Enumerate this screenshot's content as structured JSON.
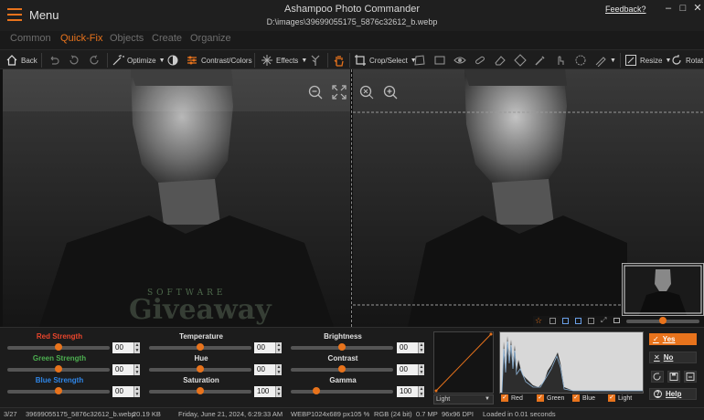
{
  "titlebar": {
    "menu_label": "Menu",
    "app_title": "Ashampoo Photo Commander",
    "file_path": "D:\\images\\39699055175_5876c32612_b.webp",
    "feedback_label": "Feedback?"
  },
  "tabs": [
    {
      "label": "Common",
      "active": false
    },
    {
      "label": "Quick-Fix",
      "active": true
    },
    {
      "label": "Objects",
      "active": false
    },
    {
      "label": "Create",
      "active": false
    },
    {
      "label": "Organize",
      "active": false
    }
  ],
  "toolbar": {
    "back_label": "Back",
    "optimize_label": "Optimize",
    "contrast_colors_label": "Contrast/Colors",
    "effects_label": "Effects",
    "crop_select_label": "Crop/Select",
    "resize_label": "Resize",
    "rotate_label": "Rotat"
  },
  "viewer": {
    "watermark_sub": "SOFTWARE",
    "watermark_main": "Giveaway"
  },
  "adjustments": {
    "col1": [
      {
        "label": "Red Strength",
        "value": "00",
        "color": "#e8452c"
      },
      {
        "label": "Green Strength",
        "value": "00",
        "color": "#4caf50"
      },
      {
        "label": "Blue Strength",
        "value": "00",
        "color": "#2f86e8"
      }
    ],
    "col2": [
      {
        "label": "Temperature",
        "value": "00"
      },
      {
        "label": "Hue",
        "value": "00"
      },
      {
        "label": "Saturation",
        "value": "100"
      }
    ],
    "col3": [
      {
        "label": "Brightness",
        "value": "00"
      },
      {
        "label": "Contrast",
        "value": "00"
      },
      {
        "label": "Gamma",
        "value": "100"
      }
    ]
  },
  "curve": {
    "mode": "Light"
  },
  "histogram_channels": [
    {
      "label": "Red",
      "checked": true
    },
    {
      "label": "Green",
      "checked": true
    },
    {
      "label": "Blue",
      "checked": true
    },
    {
      "label": "Light",
      "checked": true
    }
  ],
  "actions": {
    "yes_label": "Yes",
    "no_label": "No",
    "help_label": "Help"
  },
  "status": {
    "index": "3/27",
    "filename": "39699055175_5876c32612_b.webp",
    "size": "20.19 KB",
    "date": "Friday, June 21, 2024, 6:29:33 AM",
    "format": "WEBP",
    "dimensions": "1024x689 px",
    "zoom": "105 %",
    "color_mode": "RGB (24 bit)",
    "megapixels": "0.7 MP",
    "dpi": "96x96 DPI",
    "load_time": "Loaded in 0.01 seconds"
  },
  "colors": {
    "accent": "#e8731c"
  }
}
